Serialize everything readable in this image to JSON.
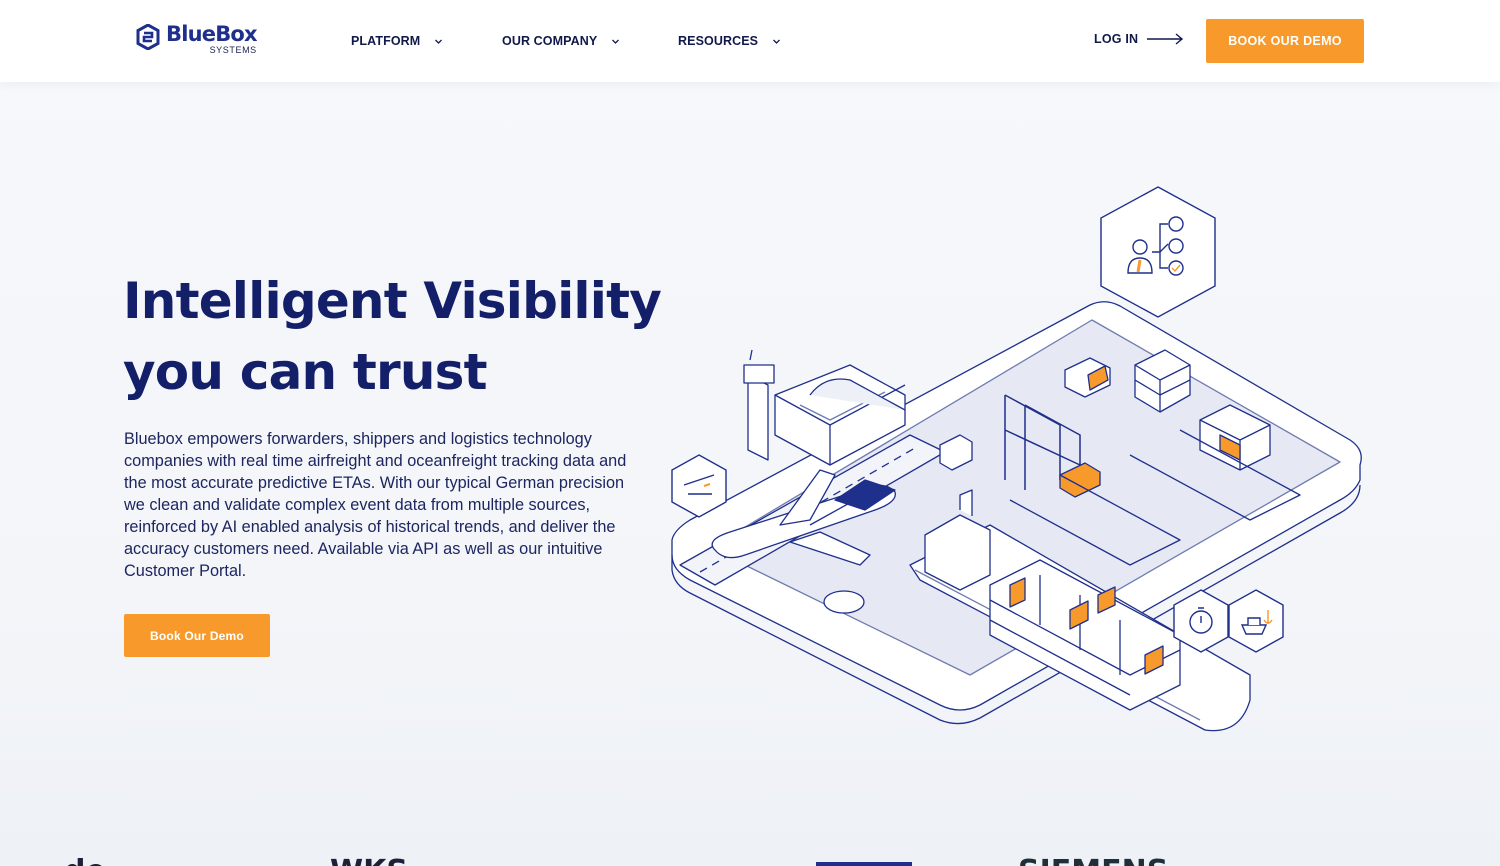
{
  "header": {
    "logo": {
      "name": "BlueBox",
      "sub": "SYSTEMS",
      "color": "#1f2f8c"
    },
    "nav": [
      {
        "label": "PLATFORM",
        "icon": "chevron-down-icon"
      },
      {
        "label": "OUR COMPANY",
        "icon": "chevron-down-icon"
      },
      {
        "label": "RESOURCES",
        "icon": "chevron-down-icon"
      }
    ],
    "login": {
      "label": "LOG IN",
      "icon": "arrow-right-icon"
    },
    "cta": {
      "label": "BOOK OUR DEMO",
      "color": "#f79a2b"
    }
  },
  "hero": {
    "title_line1": "Intelligent Visibility",
    "title_line2": "you can trust",
    "body": "Bluebox empowers forwarders, shippers and logistics technology companies with real time airfreight and oceanfreight tracking data and the most accurate predictive ETAs. With our typical German precision we clean and validate complex event data from multiple sources, reinforced by AI enabled analysis of historical trends, and deliver the accuracy customers need. Available via API as well as our intuitive Customer Portal.",
    "cta": "Book Our Demo"
  },
  "illustration": {
    "icons": [
      "workflow-hex-icon",
      "airplane-departure-hex-icon",
      "stopwatch-hex-icon",
      "ship-anchor-hex-icon"
    ],
    "accent": "#f79a2b",
    "line": "#1f2f8c"
  },
  "client_logos": [
    {
      "name": "client-logo-1",
      "text": "de"
    },
    {
      "name": "client-logo-2",
      "text": "WKS"
    },
    {
      "name": "client-logo-3",
      "text": ""
    },
    {
      "name": "client-logo-4",
      "text": "SIEMENS"
    }
  ]
}
